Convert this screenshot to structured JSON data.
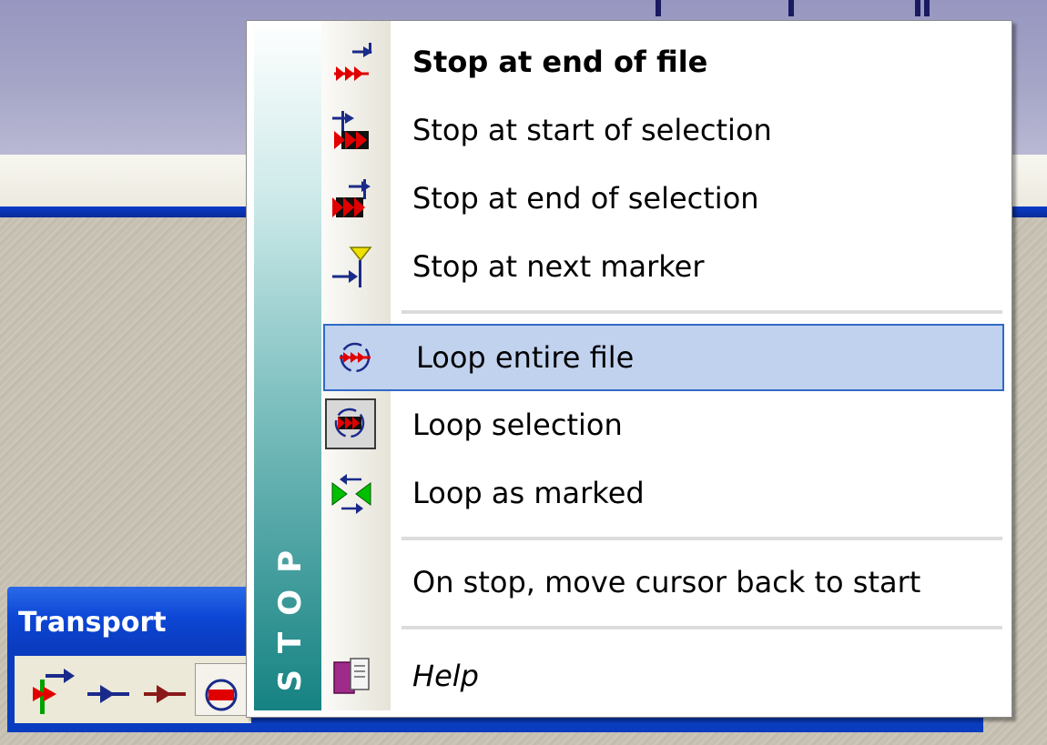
{
  "menu": {
    "sidebar_title": "STOP",
    "items": [
      {
        "label": "Stop at end of file",
        "icon": "stop-end-file-icon"
      },
      {
        "label": "Stop at start of selection",
        "icon": "stop-start-selection-icon"
      },
      {
        "label": "Stop at end of selection",
        "icon": "stop-end-selection-icon"
      },
      {
        "label": "Stop at next marker",
        "icon": "stop-next-marker-icon"
      },
      {
        "label": "Loop entire file",
        "icon": "loop-entire-file-icon",
        "highlighted": true
      },
      {
        "label": "Loop selection",
        "icon": "loop-selection-icon",
        "checked": true
      },
      {
        "label": "Loop as marked",
        "icon": "loop-as-marked-icon"
      },
      {
        "label": "On stop, move cursor back to start"
      },
      {
        "label": "Help",
        "icon": "help-book-icon"
      }
    ]
  },
  "transport": {
    "title": "Transport"
  },
  "colors": {
    "highlight_bg": "#c1d2ee",
    "highlight_border": "#316ac5",
    "sidebar_dark": "#168282",
    "titlebar_blue": "#0d47d6"
  }
}
